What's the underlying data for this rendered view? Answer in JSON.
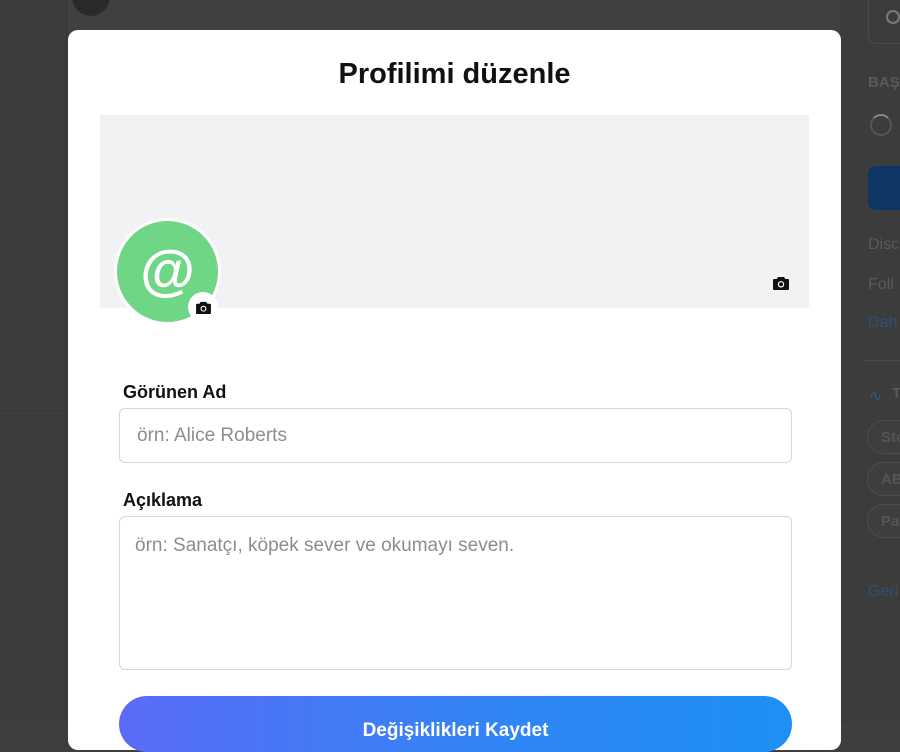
{
  "background": {
    "right_sidebar": {
      "section_heading": "BAŞ",
      "line1": "Disc",
      "line2": "Foll",
      "link": "Dah",
      "trending_heading": "T",
      "chips": [
        "Sto",
        "AB",
        "Pa"
      ],
      "footer_link": "Geri"
    }
  },
  "modal": {
    "title": "Profilimi düzenle",
    "avatar_glyph": "@",
    "display_name": {
      "label": "Görünen Ad",
      "value": "",
      "placeholder": "örn: Alice Roberts"
    },
    "description": {
      "label": "Açıklama",
      "value": "",
      "placeholder": "örn: Sanatçı, köpek sever ve okumayı seven."
    },
    "save_label": "Değişiklikleri Kaydet"
  },
  "colors": {
    "avatar": "#6fd685",
    "cover": "#f1f2f4",
    "save_gradient_start": "#5a6cf6",
    "save_gradient_end": "#1e90f5"
  },
  "icons": {
    "cover_upload": "camera-icon",
    "avatar_upload": "camera-icon",
    "background_search": "search-icon",
    "background_trending": "activity-icon"
  }
}
